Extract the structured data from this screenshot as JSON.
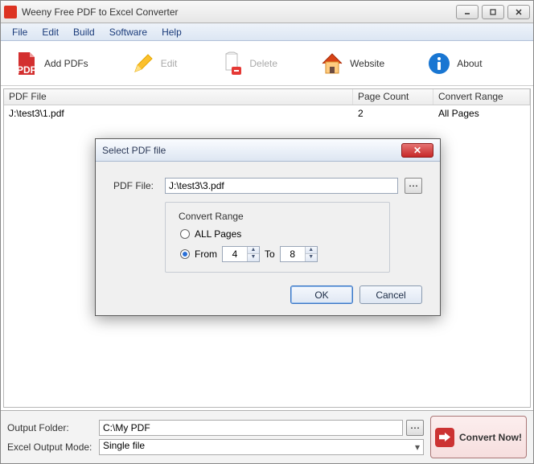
{
  "app": {
    "title": "Weeny Free PDF to Excel Converter"
  },
  "menu": {
    "items": [
      "File",
      "Edit",
      "Build",
      "Software",
      "Help"
    ]
  },
  "toolbar": {
    "add": "Add PDFs",
    "edit": "Edit",
    "delete": "Delete",
    "website": "Website",
    "about": "About"
  },
  "list": {
    "headers": {
      "file": "PDF File",
      "page": "Page Count",
      "range": "Convert Range"
    },
    "rows": [
      {
        "file": "J:\\test3\\1.pdf",
        "page": "2",
        "range": "All Pages"
      }
    ]
  },
  "dialog": {
    "title": "Select PDF file",
    "file_label": "PDF File:",
    "file_value": "J:\\test3\\3.pdf",
    "range_legend": "Convert Range",
    "all_label": "ALL Pages",
    "from_label": "From",
    "to_label": "To",
    "from_value": "4",
    "to_value": "8",
    "selected": "from",
    "ok": "OK",
    "cancel": "Cancel"
  },
  "bottom": {
    "output_label": "Output Folder:",
    "output_value": "C:\\My PDF",
    "mode_label": "Excel Output Mode:",
    "mode_value": "Single file",
    "convert": "Convert Now!"
  }
}
